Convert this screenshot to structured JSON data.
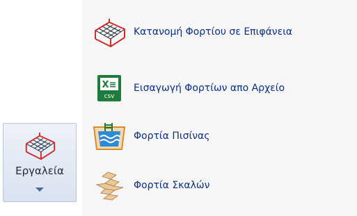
{
  "menu": {
    "items": [
      {
        "label": "Κατανομή Φορτίου σε Επιφάνεια",
        "icon": "grid-load-icon"
      },
      {
        "label": "Εισαγωγή Φορτίων απο Αρχείο",
        "icon": "csv-file-icon"
      },
      {
        "label": "Φορτία Πισίνας",
        "icon": "pool-icon"
      },
      {
        "label": "Φορτία Σκαλών",
        "icon": "stairs-icon"
      }
    ]
  },
  "tools_button": {
    "label": "Εργαλεία",
    "icon": "grid-load-icon"
  },
  "csv_icon": {
    "top_text": "X≡",
    "bottom_text": "csv"
  },
  "colors": {
    "label_text": "#0a2f84",
    "panel_bg": "#f6f6f6",
    "button_bg": "#dde6f2",
    "csv_green": "#1e7b3c",
    "grid_red": "#d12a2a"
  }
}
